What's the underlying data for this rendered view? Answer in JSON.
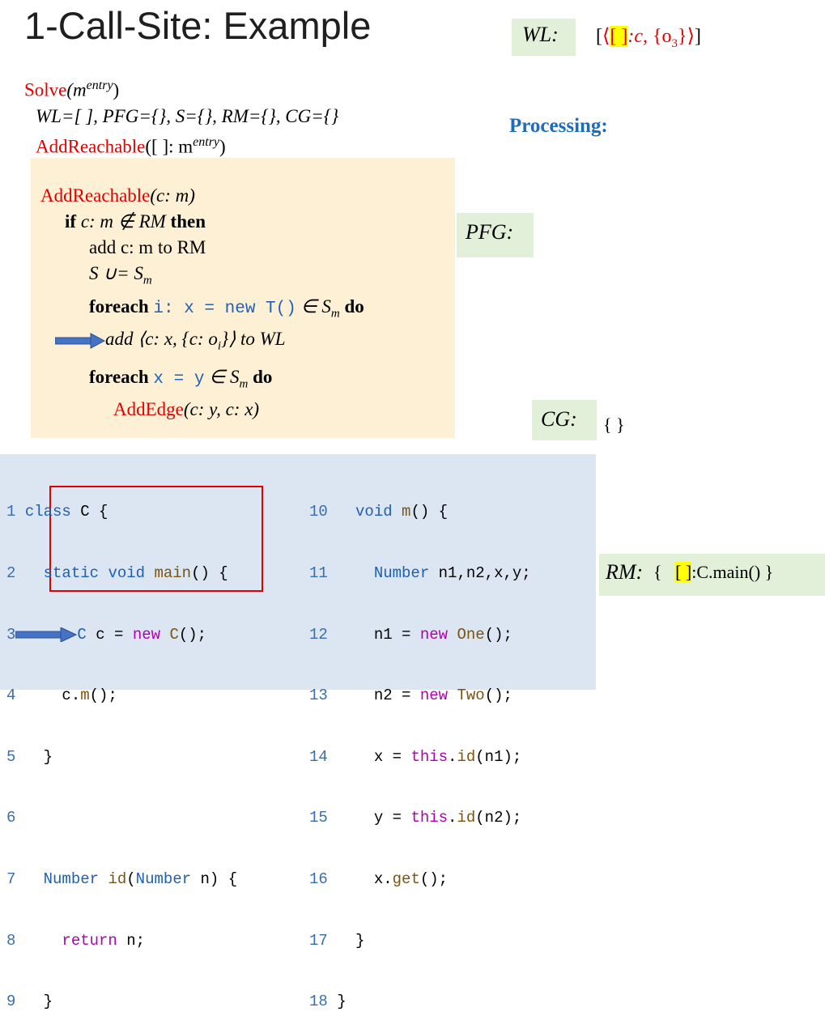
{
  "title": "1-Call-Site: Example",
  "wl": {
    "label": "WL:",
    "open_bracket": "[",
    "open_angle": "⟨",
    "context": "[ ]",
    "var": ":c, ",
    "obj": "{o",
    "obj_sub": "3",
    "obj_close": "}",
    "close_angle": "⟩",
    "close_bracket": "]"
  },
  "solve": {
    "line1_fn": "Solve",
    "line1_arg": "(m",
    "line1_sup": "entry",
    "line1_close": ")",
    "line2": "WL=[ ], PFG={}, S={}, RM={}, CG={}",
    "line3_fn": "AddReachable",
    "line3_arg": "([ ]: m",
    "line3_sup": "entry",
    "line3_close": ")"
  },
  "processing": "Processing:",
  "algo": {
    "l1_fn": "AddReachable",
    "l1_arg": "(c: m)",
    "l2_if": "if",
    "l2_cond": " c: m ∉ RM ",
    "l2_then": "then",
    "l3": "add c: m to RM",
    "l4": "S ∪= S",
    "l4_sub": "m",
    "l5_foreach": "foreach",
    "l5_code": "i: x = new T()",
    "l5_in": " ∈ S",
    "l5_sub": "m",
    "l5_do": " do",
    "l6_text": "add ⟨c: x, {c: o",
    "l6_sub": "i",
    "l6_end": "}⟩ to WL",
    "l7_foreach": "foreach",
    "l7_code": "x = y",
    "l7_in": " ∈ S",
    "l7_sub": "m",
    "l7_do": " do",
    "l8_fn": "AddEdge",
    "l8_arg": "(c: y, c: x)"
  },
  "pfg": {
    "label": "PFG:"
  },
  "cg": {
    "label": "CG:",
    "value": "{ }"
  },
  "rm": {
    "label": "RM:",
    "open": "{",
    "context": "[ ]",
    "method": ":C.main()",
    "close": "}"
  },
  "code_left": [
    {
      "n": "1",
      "text": "class C {"
    },
    {
      "n": "2",
      "text": "  static void main() {"
    },
    {
      "n": "3",
      "text": "C c = new C();"
    },
    {
      "n": "4",
      "text": "    c.m();"
    },
    {
      "n": "5",
      "text": "  }"
    },
    {
      "n": "6",
      "text": ""
    },
    {
      "n": "7",
      "text": "  Number id(Number n) {"
    },
    {
      "n": "8",
      "text": "    return n;"
    },
    {
      "n": "9",
      "text": "  }"
    }
  ],
  "code_right": [
    {
      "n": "10",
      "text": "  void m() {"
    },
    {
      "n": "11",
      "text": "    Number n1,n2,x,y;"
    },
    {
      "n": "12",
      "text": "    n1 = new One();"
    },
    {
      "n": "13",
      "text": "    n2 = new Two();"
    },
    {
      "n": "14",
      "text": "    x = this.id(n1);"
    },
    {
      "n": "15",
      "text": "    y = this.id(n2);"
    },
    {
      "n": "16",
      "text": "    x.get();"
    },
    {
      "n": "17",
      "text": "  }"
    },
    {
      "n": "18",
      "text": "}"
    }
  ],
  "colors": {
    "highlight": "#ffff00",
    "context_red": "#e00000",
    "keyword_blue": "#1f60b8",
    "panel_green": "#e2efd9",
    "panel_beige": "#fdf0d4",
    "panel_blue": "#dce6f2"
  }
}
